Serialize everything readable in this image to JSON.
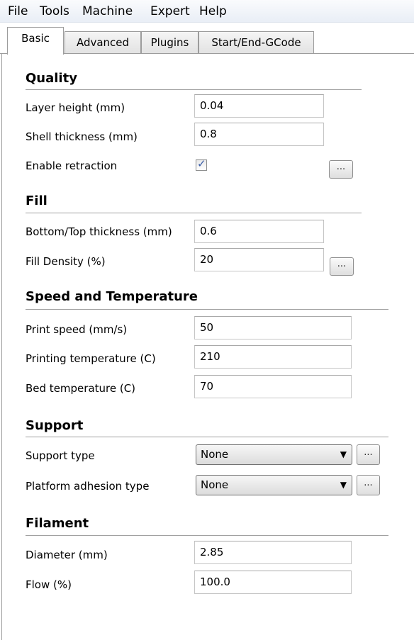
{
  "menu": [
    "File",
    "Tools",
    "Machine",
    "Expert",
    "Help"
  ],
  "tabs": [
    "Basic",
    "Advanced",
    "Plugins",
    "Start/End-GCode"
  ],
  "active_tab": "Basic",
  "quality": {
    "heading": "Quality",
    "layer_height_label": "Layer height (mm)",
    "layer_height_value": "0.04",
    "shell_thickness_label": "Shell thickness (mm)",
    "shell_thickness_value": "0.8",
    "retraction_label": "Enable retraction",
    "retraction_checked": true
  },
  "fill": {
    "heading": "Fill",
    "bottom_top_label": "Bottom/Top thickness (mm)",
    "bottom_top_value": "0.6",
    "fill_density_label": "Fill Density (%)",
    "fill_density_value": "20"
  },
  "speed": {
    "heading": "Speed and Temperature",
    "print_speed_label": "Print speed (mm/s)",
    "print_speed_value": "50",
    "printing_temp_label": "Printing temperature (C)",
    "printing_temp_value": "210",
    "bed_temp_label": "Bed temperature (C)",
    "bed_temp_value": "70"
  },
  "support": {
    "heading": "Support",
    "support_type_label": "Support type",
    "support_type_value": "None",
    "adhesion_label": "Platform adhesion type",
    "adhesion_value": "None"
  },
  "filament": {
    "heading": "Filament",
    "diameter_label": "Diameter (mm)",
    "diameter_value": "2.85",
    "flow_label": "Flow (%)",
    "flow_value": "100.0"
  },
  "more_button_label": "...",
  "icons": {
    "checkbox": "checkmark-icon",
    "dropdown": "chevron-down-icon"
  }
}
